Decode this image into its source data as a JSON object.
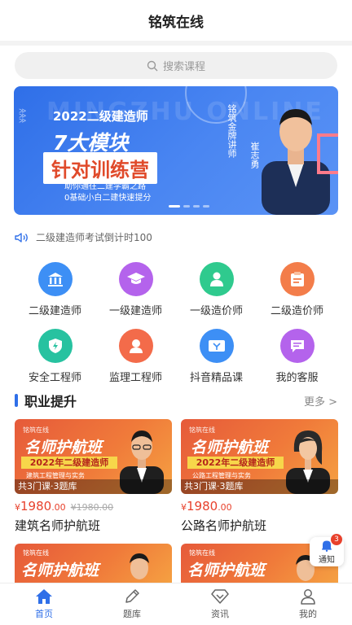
{
  "header": {
    "title": "铭筑在线"
  },
  "search": {
    "placeholder": "搜索课程"
  },
  "banner": {
    "tag": "2022二级建造师",
    "headline": "7大模块",
    "highlight": "针对训练营",
    "line1": "助你通往二建学霸之路",
    "line2": "0基础小白二建快速提分",
    "teacher_title": "铭筑金牌讲师",
    "teacher_name": "崔志勇",
    "watermark": "MINGZHU ONLINE"
  },
  "notice": {
    "text": "二级建造师考试倒计时100"
  },
  "categories": [
    {
      "label": "二级建造师",
      "icon": "building-icon",
      "color": "#3d8ff5"
    },
    {
      "label": "一级建造师",
      "icon": "graduation-cap-icon",
      "color": "#b463ec"
    },
    {
      "label": "一级造价师",
      "icon": "person-icon",
      "color": "#2fca8e"
    },
    {
      "label": "二级造价师",
      "icon": "clipboard-icon",
      "color": "#f37d4a"
    },
    {
      "label": "安全工程师",
      "icon": "shield-icon",
      "color": "#27c2a0"
    },
    {
      "label": "监理工程师",
      "icon": "user-icon",
      "color": "#f36b4a"
    },
    {
      "label": "抖音精品课",
      "icon": "video-icon",
      "color": "#3d8ff5"
    },
    {
      "label": "我的客服",
      "icon": "chat-icon",
      "color": "#b463ec"
    }
  ],
  "section": {
    "title": "职业提升",
    "more": "更多 >"
  },
  "courses": [
    {
      "brand": "铭筑在线",
      "thumb_title": "名师护航班",
      "thumb_sub": "2022年二级建造师",
      "thumb_topic": "建筑工程管理与实务",
      "caption": "共3门课·3题库",
      "price_symbol": "¥",
      "price": "1980",
      "price_dec": ".00",
      "old_price": "¥1980.00",
      "name": "建筑名师护航班"
    },
    {
      "brand": "铭筑在线",
      "thumb_title": "名师护航班",
      "thumb_sub": "2022年二级建造师",
      "thumb_topic": "公路工程管理与实务",
      "caption": "共3门课·3题库",
      "price_symbol": "¥",
      "price": "1980",
      "price_dec": ".00",
      "name": "公路名师护航班"
    },
    {
      "brand": "铭筑在线",
      "thumb_title": "名师护航班"
    },
    {
      "brand": "铭筑在线",
      "thumb_title": "名师护航班"
    }
  ],
  "notify": {
    "label": "通知",
    "count": "3"
  },
  "tabs": [
    {
      "label": "首页",
      "icon": "home-icon"
    },
    {
      "label": "题库",
      "icon": "pencil-icon"
    },
    {
      "label": "资讯",
      "icon": "diamond-icon"
    },
    {
      "label": "我的",
      "icon": "profile-icon"
    }
  ],
  "colors": {
    "accent": "#2f6fe8",
    "price": "#e8412c"
  }
}
